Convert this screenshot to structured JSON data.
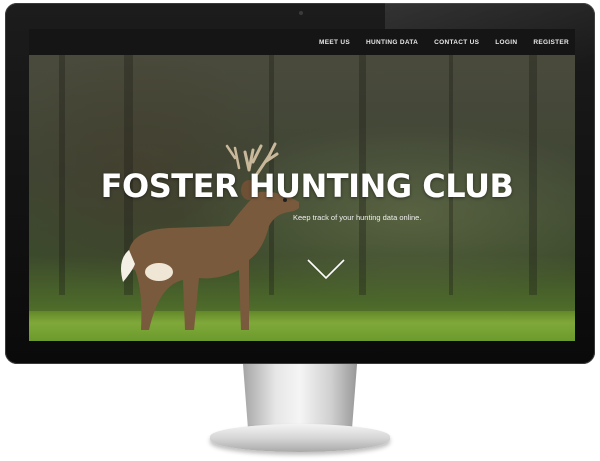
{
  "nav": {
    "items": [
      {
        "label": "MEET US"
      },
      {
        "label": "HUNTING DATA"
      },
      {
        "label": "CONTACT US"
      },
      {
        "label": "LOGIN"
      },
      {
        "label": "REGISTER"
      }
    ]
  },
  "hero": {
    "title": "FOSTER HUNTING CLUB",
    "subtitle": "Keep track of your hunting data online.",
    "scroll_icon": "chevron-down-icon"
  },
  "colors": {
    "navbar": "#151515",
    "nav_text": "#e8e8e8",
    "title": "#ffffff"
  }
}
